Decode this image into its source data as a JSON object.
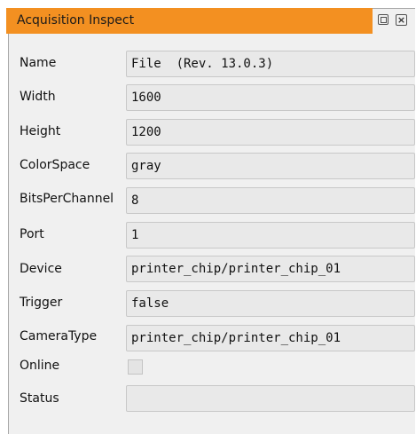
{
  "window": {
    "title": "Acquisition Inspect",
    "float_icon": "float-window-icon",
    "close_icon": "close-icon"
  },
  "properties": [
    {
      "label": "Name",
      "value": "File  (Rev. 13.0.3)"
    },
    {
      "label": "Width",
      "value": "1600"
    },
    {
      "label": "Height",
      "value": "1200"
    },
    {
      "label": "ColorSpace",
      "value": "gray"
    },
    {
      "label": "BitsPerChannel",
      "value": "8"
    },
    {
      "label": "Port",
      "value": "1"
    },
    {
      "label": "Device",
      "value": "printer_chip/printer_chip_01"
    },
    {
      "label": "Trigger",
      "value": "false"
    },
    {
      "label": "CameraType",
      "value": "printer_chip/printer_chip_01"
    },
    {
      "label": "Online",
      "value": ""
    },
    {
      "label": "Status",
      "value": ""
    }
  ],
  "online": {
    "checked": false
  }
}
